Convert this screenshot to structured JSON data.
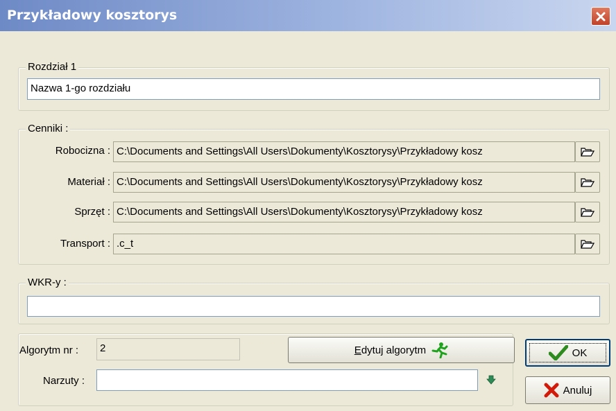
{
  "window": {
    "title": "Przykładowy kosztorys"
  },
  "rozdzial": {
    "legend": "Rozdział 1",
    "name_value": "Nazwa 1-go rozdziału"
  },
  "cenniki": {
    "legend": "Cenniki :",
    "rows": [
      {
        "label": "Robocizna :",
        "value": "C:\\Documents and Settings\\All Users\\Dokumenty\\Kosztorysy\\Przykładowy kosz"
      },
      {
        "label": "Materiał :",
        "value": "C:\\Documents and Settings\\All Users\\Dokumenty\\Kosztorysy\\Przykładowy kosz"
      },
      {
        "label": "Sprzęt :",
        "value": "C:\\Documents and Settings\\All Users\\Dokumenty\\Kosztorysy\\Przykładowy kosz"
      },
      {
        "label": "Transport :",
        "value": ".c_t"
      }
    ]
  },
  "wkr": {
    "legend": "WKR-y :",
    "value": ""
  },
  "algorytm": {
    "label": "Algorytm nr :",
    "value": "2",
    "edit_button_prefix": "E",
    "edit_button_rest": "dytuj algorytm"
  },
  "narzuty": {
    "label": "Narzuty :",
    "value": ""
  },
  "buttons": {
    "ok": "OK",
    "cancel": "Anuluj"
  },
  "icons": {
    "close": "close-icon",
    "browse": "open-folder-icon",
    "edit": "running-man-icon",
    "dropdown": "green-down-arrow-icon",
    "ok": "checkmark-icon",
    "cancel": "red-x-icon"
  },
  "colors": {
    "title_gradient_start": "#6e8ac6",
    "dialog_bg": "#ece9d8",
    "close_red": "#c0432a",
    "ok_green": "#2e8b1f",
    "cancel_red": "#d21a0a"
  }
}
